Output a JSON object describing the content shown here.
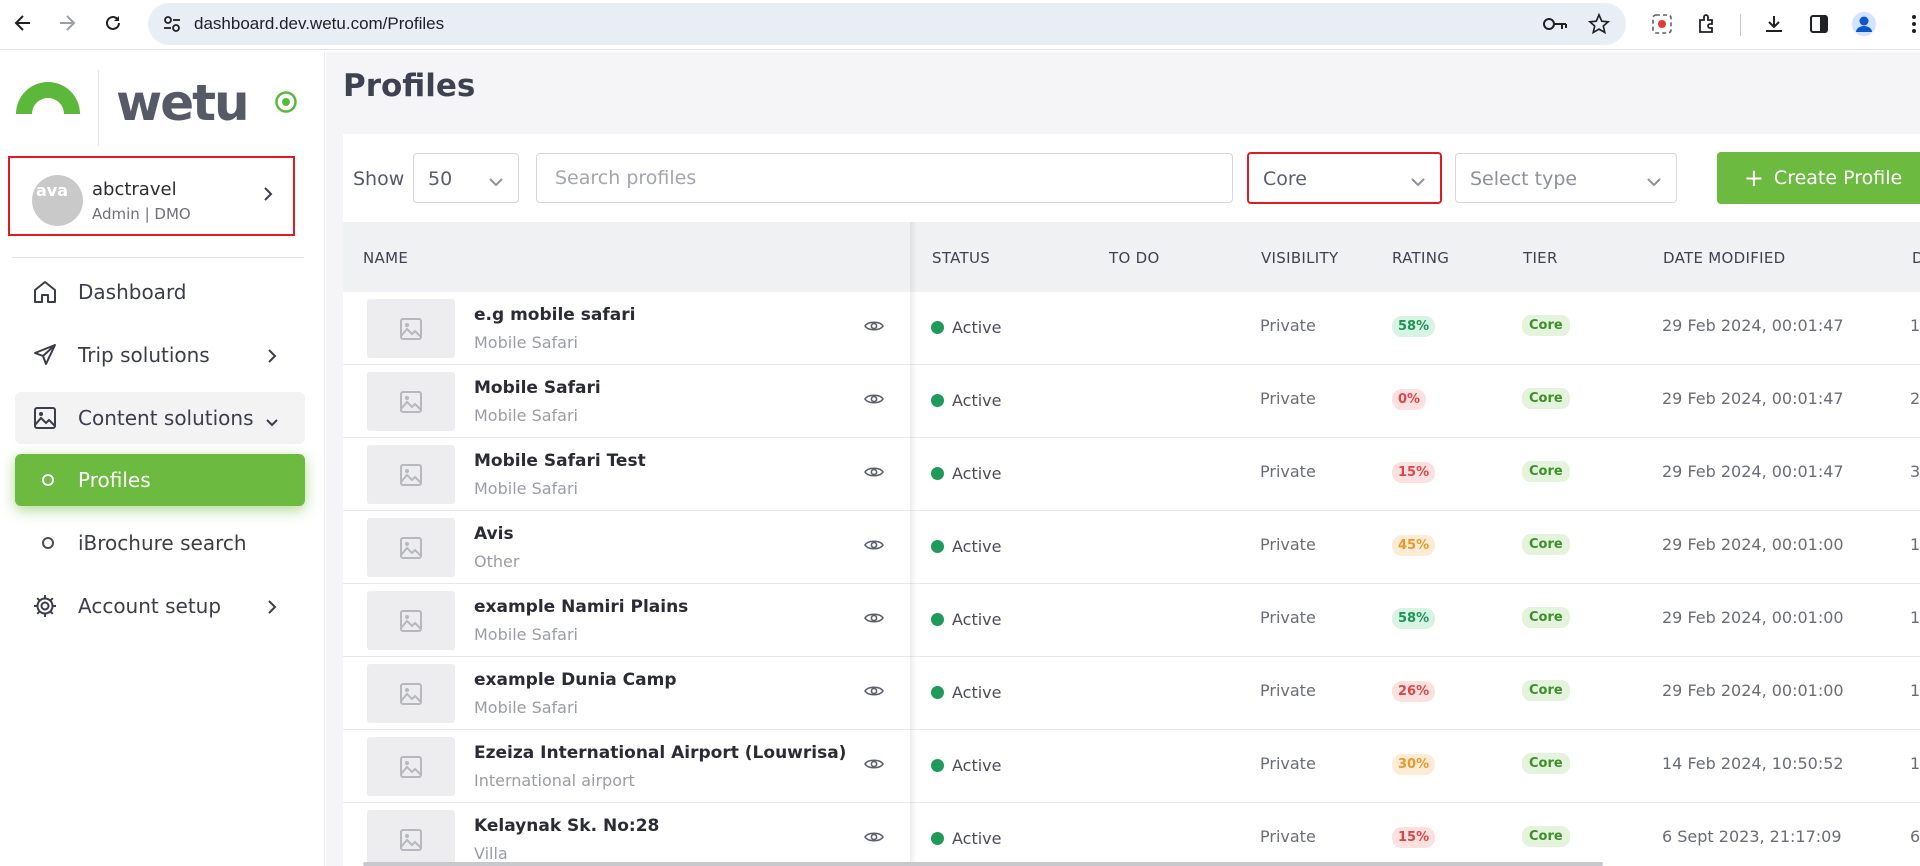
{
  "browser": {
    "url": "dashboard.dev.wetu.com/Profiles",
    "icons": [
      "back-arrow-icon",
      "forward-arrow-icon",
      "reload-icon",
      "site-settings-icon",
      "key-icon",
      "bookmark-star-icon",
      "screen-record-icon",
      "extensions-icon",
      "download-icon",
      "side-panel-icon",
      "account-icon",
      "menu-dots-icon"
    ]
  },
  "sidebar": {
    "logo_text": "wetu",
    "user": {
      "avatar_alt": "ava",
      "name": "abctravel",
      "role": "Admin | DMO"
    },
    "items": [
      {
        "label": "Dashboard",
        "icon": "home-icon"
      },
      {
        "label": "Trip solutions",
        "icon": "send-icon"
      },
      {
        "label": "Content solutions",
        "icon": "image-icon"
      },
      {
        "label": "Profiles",
        "icon": "circle-icon"
      },
      {
        "label": "iBrochure search",
        "icon": "circle-icon"
      },
      {
        "label": "Account setup",
        "icon": "gear-icon"
      }
    ]
  },
  "main": {
    "title": "Profiles",
    "toolbar": {
      "show_label": "Show",
      "page_size": "50",
      "search_placeholder": "Search profiles",
      "tier_filter": "Core",
      "type_filter": "Select type",
      "create_label": "Create Profile"
    },
    "columns": [
      "NAME",
      "STATUS",
      "TO DO",
      "VISIBILITY",
      "RATING",
      "TIER",
      "DATE MODIFIED",
      "D"
    ],
    "rows": [
      {
        "name": "e.g mobile safari",
        "type": "Mobile Safari",
        "status": "Active",
        "visibility": "Private",
        "rating": "58%",
        "tier": "Core",
        "date": "29 Feb 2024, 00:01:47",
        "extra": "1"
      },
      {
        "name": "Mobile Safari",
        "type": "Mobile Safari",
        "status": "Active",
        "visibility": "Private",
        "rating": "0%",
        "tier": "Core",
        "date": "29 Feb 2024, 00:01:47",
        "extra": "2"
      },
      {
        "name": "Mobile Safari Test",
        "type": "Mobile Safari",
        "status": "Active",
        "visibility": "Private",
        "rating": "15%",
        "tier": "Core",
        "date": "29 Feb 2024, 00:01:47",
        "extra": "3"
      },
      {
        "name": "Avis",
        "type": "Other",
        "status": "Active",
        "visibility": "Private",
        "rating": "45%",
        "tier": "Core",
        "date": "29 Feb 2024, 00:01:00",
        "extra": "1"
      },
      {
        "name": "example Namiri Plains",
        "type": "Mobile Safari",
        "status": "Active",
        "visibility": "Private",
        "rating": "58%",
        "tier": "Core",
        "date": "29 Feb 2024, 00:01:00",
        "extra": "1"
      },
      {
        "name": "example Dunia Camp",
        "type": "Mobile Safari",
        "status": "Active",
        "visibility": "Private",
        "rating": "26%",
        "tier": "Core",
        "date": "29 Feb 2024, 00:01:00",
        "extra": "1"
      },
      {
        "name": "Ezeiza International Airport (Louwrisa)",
        "type": "International airport",
        "status": "Active",
        "visibility": "Private",
        "rating": "30%",
        "tier": "Core",
        "date": "14 Feb 2024, 10:50:52",
        "extra": "1"
      },
      {
        "name": "Kelaynak Sk. No:28",
        "type": "Villa",
        "status": "Active",
        "visibility": "Private",
        "rating": "15%",
        "tier": "Core",
        "date": "6 Sept 2023, 21:17:09",
        "extra": "6"
      }
    ]
  },
  "colors": {
    "brand_green": "#6dba40",
    "highlight_red": "#e21b22",
    "status_active": "#1e9b5a",
    "rating_high_bg": "#d6f3e3",
    "rating_high_fg": "#1f9458",
    "rating_mid_bg": "#fdecd5",
    "rating_mid_fg": "#e69a2e",
    "rating_low_bg": "#fde0e0",
    "rating_low_fg": "#d94848"
  }
}
